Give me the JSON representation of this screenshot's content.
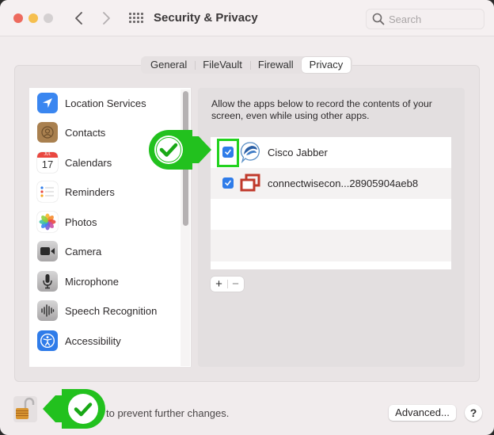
{
  "window": {
    "title": "Security & Privacy",
    "traffic_lights": [
      "close",
      "minimize",
      "zoom"
    ],
    "nav": {
      "back_icon": "chevron-left-icon",
      "forward_icon": "chevron-right-icon",
      "grid_icon": "show-all-grid-icon"
    }
  },
  "search": {
    "placeholder": "Search",
    "value": "",
    "icon": "search-icon"
  },
  "tabs": [
    {
      "label": "General",
      "active": false
    },
    {
      "label": "FileVault",
      "active": false
    },
    {
      "label": "Firewall",
      "active": false
    },
    {
      "label": "Privacy",
      "active": true
    }
  ],
  "sidebar": {
    "items": [
      {
        "label": "Location Services",
        "icon": "location-arrow-icon"
      },
      {
        "label": "Contacts",
        "icon": "contacts-book-icon"
      },
      {
        "label": "Calendars",
        "icon": "calendar-icon",
        "icon_text": "17",
        "icon_month": "JUL"
      },
      {
        "label": "Reminders",
        "icon": "reminders-list-icon"
      },
      {
        "label": "Photos",
        "icon": "photos-flower-icon"
      },
      {
        "label": "Camera",
        "icon": "camera-icon"
      },
      {
        "label": "Microphone",
        "icon": "microphone-icon"
      },
      {
        "label": "Speech Recognition",
        "icon": "waveform-icon"
      },
      {
        "label": "Accessibility",
        "icon": "accessibility-icon"
      }
    ]
  },
  "detail": {
    "description": "Allow the apps below to record the contents of your screen, even while using other apps.",
    "apps": [
      {
        "name": "Cisco Jabber",
        "checked": true,
        "icon": "cisco-jabber-icon"
      },
      {
        "name": "connectwisecon...28905904aeb8",
        "checked": true,
        "icon": "connectwise-control-icon"
      }
    ],
    "add_label": "+",
    "remove_label": "−"
  },
  "footer": {
    "lock_text": "to prevent further changes.",
    "lock_state": "unlocked",
    "advanced_label": "Advanced...",
    "help_label": "?"
  },
  "annotations": {
    "color": "#22c11e",
    "items": [
      "checkbox-callout",
      "lock-callout"
    ]
  }
}
